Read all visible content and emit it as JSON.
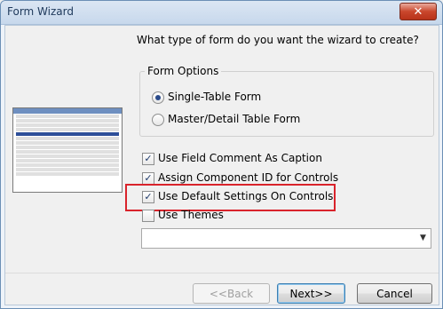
{
  "window": {
    "title": "Form Wizard",
    "close_glyph": "✕"
  },
  "prompt": "What type of form do you want the wizard to create?",
  "form_options": {
    "group_title": "Form Options",
    "single_table_label": "Single-Table Form",
    "single_table_selected": true,
    "master_detail_label": "Master/Detail Table Form",
    "master_detail_selected": false
  },
  "checkboxes": {
    "field_comment_label": "Use Field Comment As Caption",
    "field_comment_checked": true,
    "component_id_label": "Assign Component ID for Controls",
    "component_id_checked": true,
    "default_settings_label": "Use Default Settings On Controls",
    "default_settings_checked": true,
    "themes_label": "Use Themes",
    "themes_checked": false
  },
  "check_glyph": "✓",
  "themes_combo": {
    "value": "",
    "arrow_glyph": "▼"
  },
  "buttons": {
    "back": "<<Back",
    "next": "Next>>",
    "cancel": "Cancel"
  },
  "colors": {
    "highlight": "#d9232b",
    "title_bar": "#c7d8ec"
  }
}
